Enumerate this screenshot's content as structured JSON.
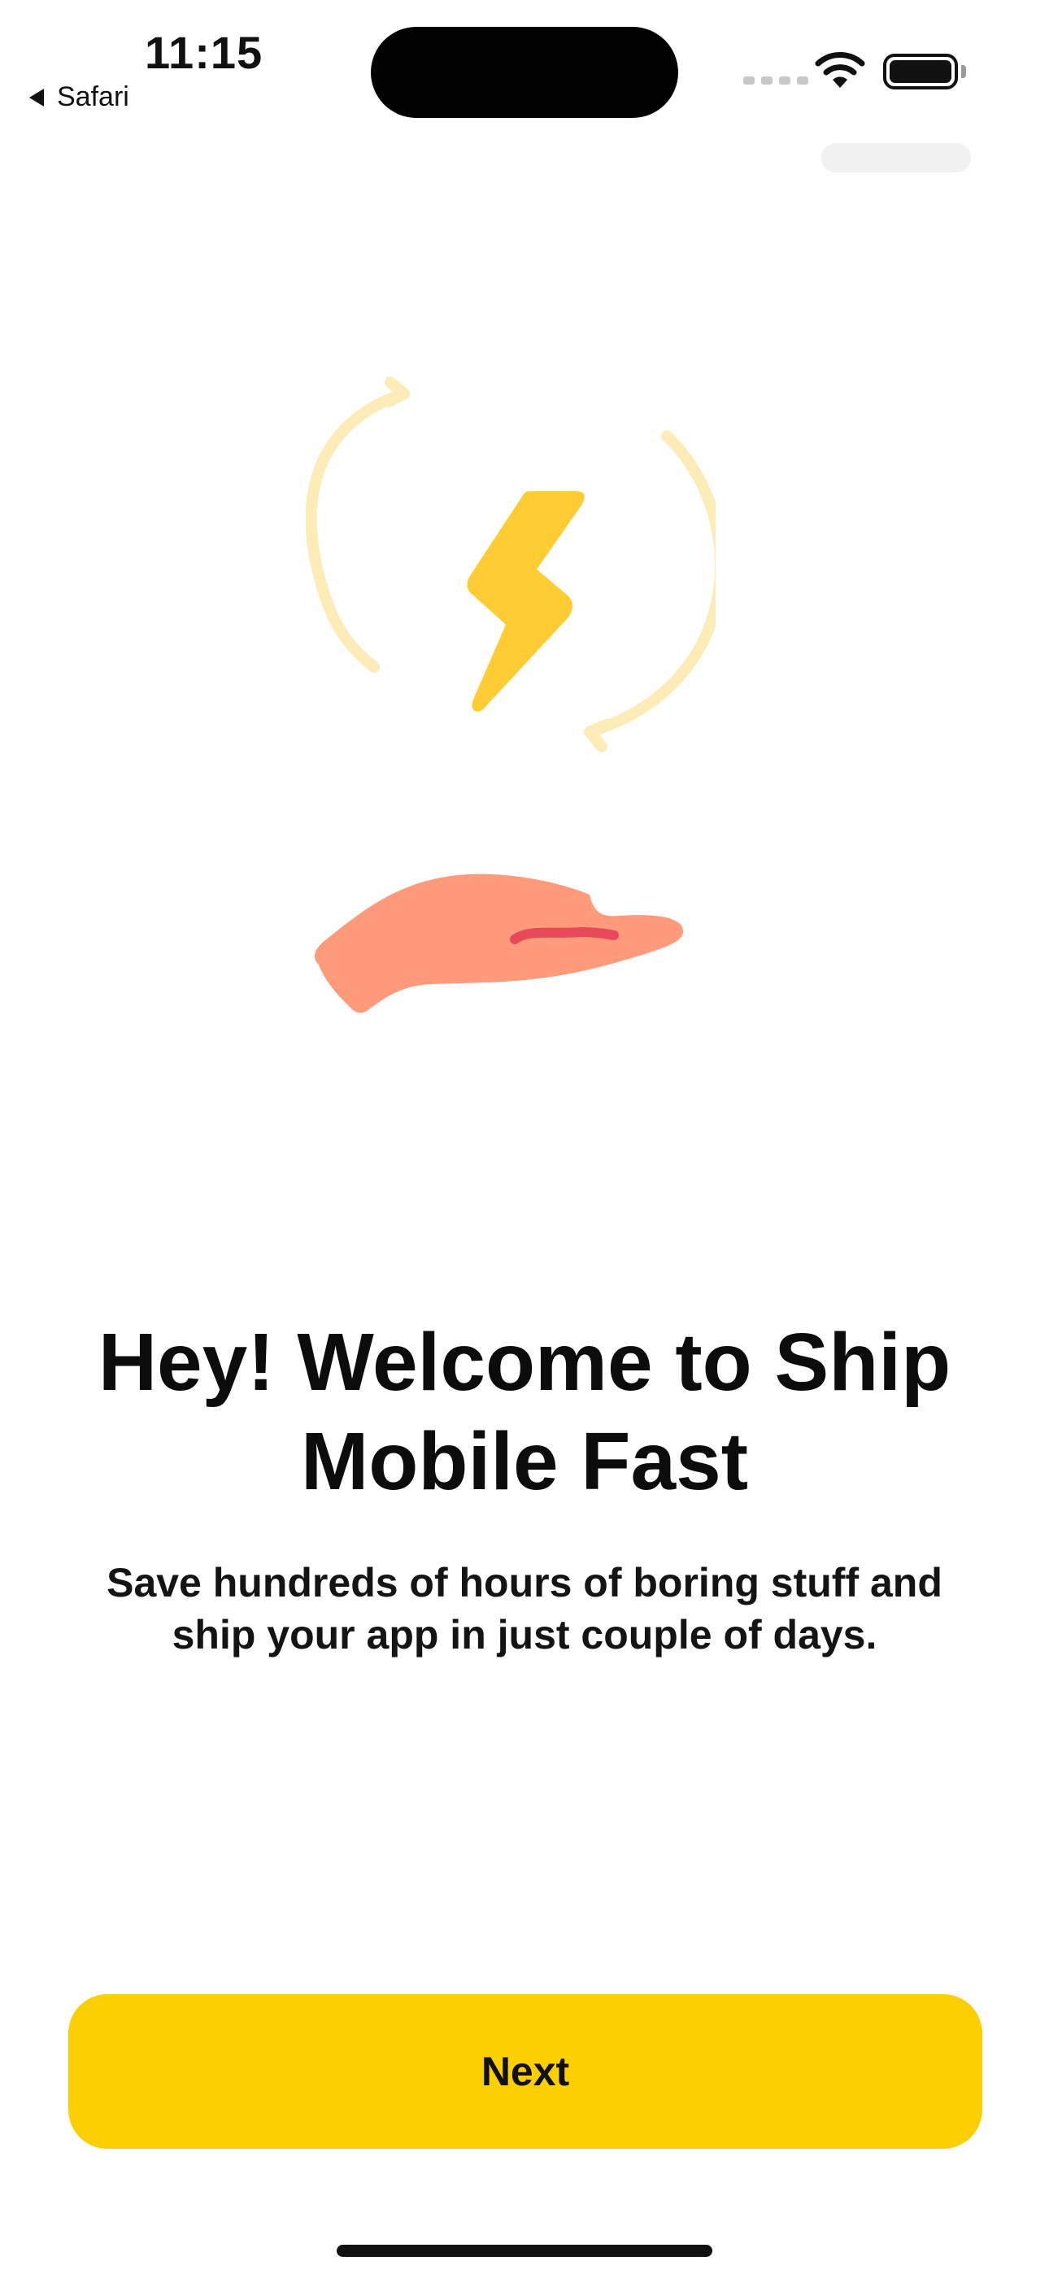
{
  "status_bar": {
    "time": "11:15",
    "back_app": "Safari"
  },
  "onboarding": {
    "title": "Hey! Welcome to Ship Mobile Fast",
    "subtitle": "Save hundreds of hours of boring stuff and ship your app in just couple of days.",
    "next_label": "Next"
  },
  "colors": {
    "accent": "#fccf03",
    "bolt": "#ffcd33",
    "arrows": "#fdecb8",
    "hand": "#ff9a7a",
    "hand_line": "#e8495a"
  },
  "icons": [
    "back-arrow-icon",
    "wifi-icon",
    "battery-icon",
    "refresh-arrows-icon",
    "lightning-bolt-icon",
    "open-hand-icon"
  ]
}
